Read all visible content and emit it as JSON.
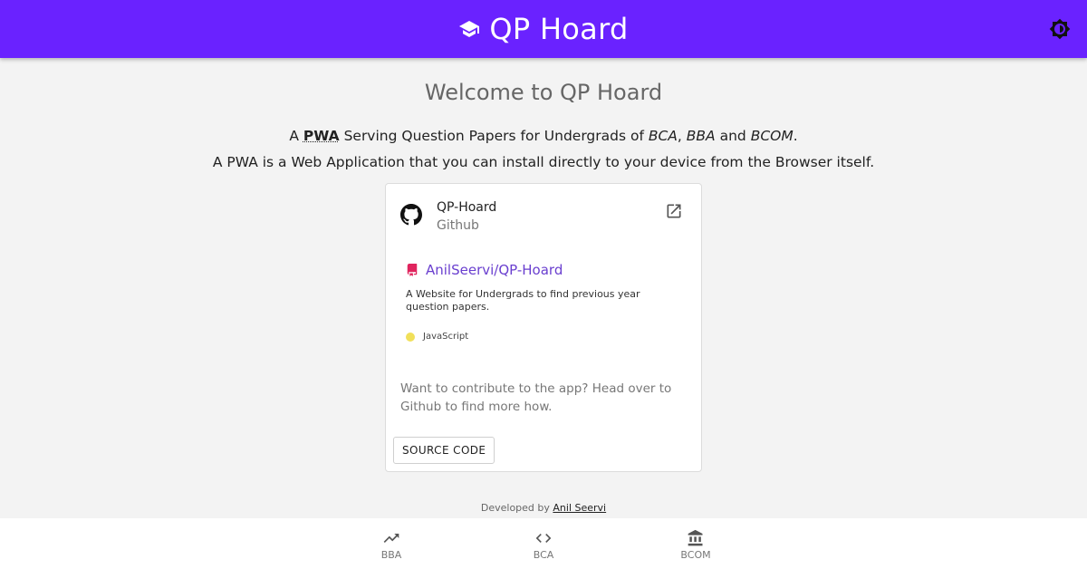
{
  "header": {
    "title": "QP Hoard",
    "logo_icon": "graduation-cap-icon",
    "theme_icon": "brightness-icon",
    "bg_color": "#6a22ff"
  },
  "main": {
    "welcome": "Welcome to QP Hoard",
    "intro_line1": {
      "prefix": "A",
      "pwa": "PWA",
      "middle": "Serving Question Papers for Undergrads of",
      "course1": "BCA",
      "sep1": ",",
      "course2": "BBA",
      "and": "and",
      "course3": "BCOM",
      "end": "."
    },
    "intro_line2": "A PWA is a Web Application that you can install directly to your device from the Browser itself."
  },
  "card": {
    "title": "QP-Hoard",
    "subtitle": "Github",
    "avatar_icon": "github-icon",
    "open_icon": "open-in-new-icon",
    "repo": {
      "icon": "repo-icon",
      "name": "AnilSeervi/QP-Hoard",
      "description": "A Website for Undergrads to find previous year question papers.",
      "language": "JavaScript",
      "language_color": "#f1e05a"
    },
    "contribute_text": "Want to contribute to the app? Head over to Github to find more how.",
    "source_button": "SOURCE CODE"
  },
  "footer": {
    "prefix": "Developed by",
    "author": "Anil Seervi"
  },
  "bottom_nav": [
    {
      "label": "BBA",
      "icon": "trending-up-icon"
    },
    {
      "label": "BCA",
      "icon": "code-icon"
    },
    {
      "label": "BCOM",
      "icon": "bank-icon"
    }
  ]
}
